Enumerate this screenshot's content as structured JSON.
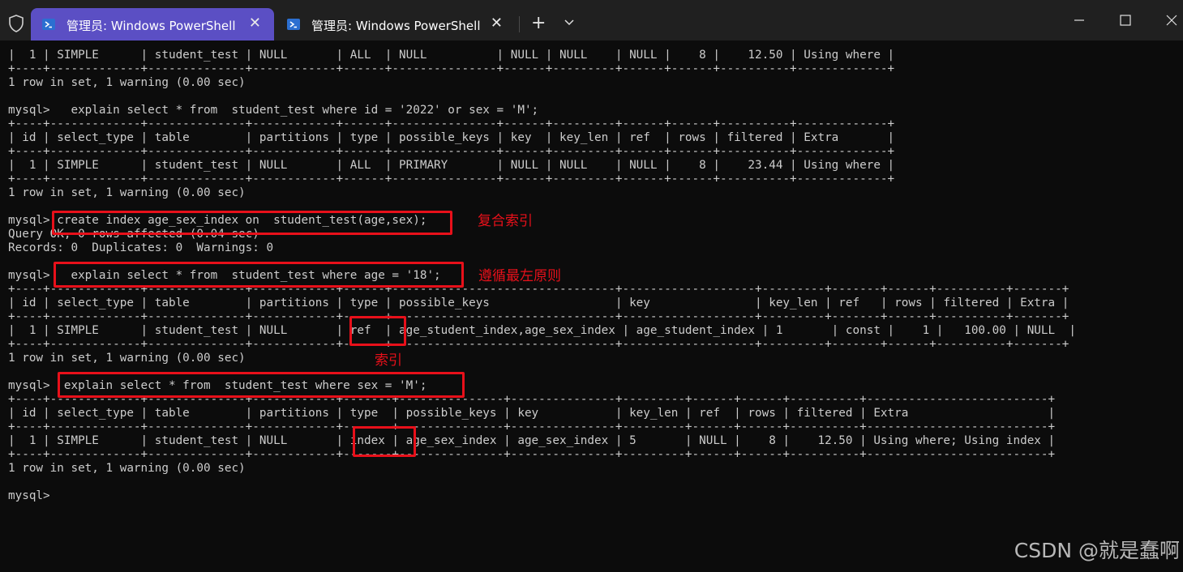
{
  "window": {
    "tabs": [
      {
        "title": "管理员: Windows PowerShell",
        "active": true
      },
      {
        "title": "管理员: Windows PowerShell",
        "active": false
      }
    ],
    "new_tab_glyph": "+",
    "close_glyph": "✕",
    "accent": "#5b4fc4"
  },
  "terminal": {
    "lines": [
      "|  1 | SIMPLE      | student_test | NULL       | ALL  | NULL          | NULL | NULL    | NULL |    8 |    12.50 | Using where |",
      "+----+-------------+--------------+------------+------+---------------+------+---------+------+------+----------+-------------+",
      "1 row in set, 1 warning (0.00 sec)",
      "",
      "mysql>   explain select * from  student_test where id = '2022' or sex = 'M';",
      "+----+-------------+--------------+------------+------+---------------+------+---------+------+------+----------+-------------+",
      "| id | select_type | table        | partitions | type | possible_keys | key  | key_len | ref  | rows | filtered | Extra       |",
      "+----+-------------+--------------+------------+------+---------------+------+---------+------+------+----------+-------------+",
      "|  1 | SIMPLE      | student_test | NULL       | ALL  | PRIMARY       | NULL | NULL    | NULL |    8 |    23.44 | Using where |",
      "+----+-------------+--------------+------------+------+---------------+------+---------+------+------+----------+-------------+",
      "1 row in set, 1 warning (0.00 sec)",
      "",
      "mysql> create index age_sex_index on  student_test(age,sex);",
      "Query OK, 0 rows affected (0.04 sec)",
      "Records: 0  Duplicates: 0  Warnings: 0",
      "",
      "mysql>   explain select * from  student_test where age = '18';",
      "+----+-------------+--------------+------------+------+--------------------------------+-------------------+---------+-------+------+----------+-------+",
      "| id | select_type | table        | partitions | type | possible_keys                  | key               | key_len | ref   | rows | filtered | Extra |",
      "+----+-------------+--------------+------------+------+--------------------------------+-------------------+---------+-------+------+----------+-------+",
      "|  1 | SIMPLE      | student_test | NULL       | ref  | age_student_index,age_sex_index | age_student_index | 1       | const |    1 |   100.00 | NULL  |",
      "+----+-------------+--------------+------------+------+--------------------------------+-------------------+---------+-------+------+----------+-------+",
      "1 row in set, 1 warning (0.00 sec)",
      "",
      "mysql>  explain select * from  student_test where sex = 'M';",
      "+----+-------------+--------------+------------+-------+---------------+---------------+---------+------+------+----------+--------------------------+",
      "| id | select_type | table        | partitions | type  | possible_keys | key           | key_len | ref  | rows | filtered | Extra                    |",
      "+----+-------------+--------------+------------+-------+---------------+---------------+---------+------+------+----------+--------------------------+",
      "|  1 | SIMPLE      | student_test | NULL       | index | age_sex_index | age_sex_index | 5       | NULL |    8 |    12.50 | Using where; Using index |",
      "+----+-------------+--------------+------------+-------+---------------+---------------+---------+------+------+----------+--------------------------+",
      "1 row in set, 1 warning (0.00 sec)",
      "",
      "mysql>"
    ]
  },
  "annotations": {
    "composite_index": "复合索引",
    "leftmost_prefix": "遵循最左原则",
    "index": "索引",
    "highlight_color": "#e8101a"
  },
  "watermark": "CSDN @就是蠢啊"
}
